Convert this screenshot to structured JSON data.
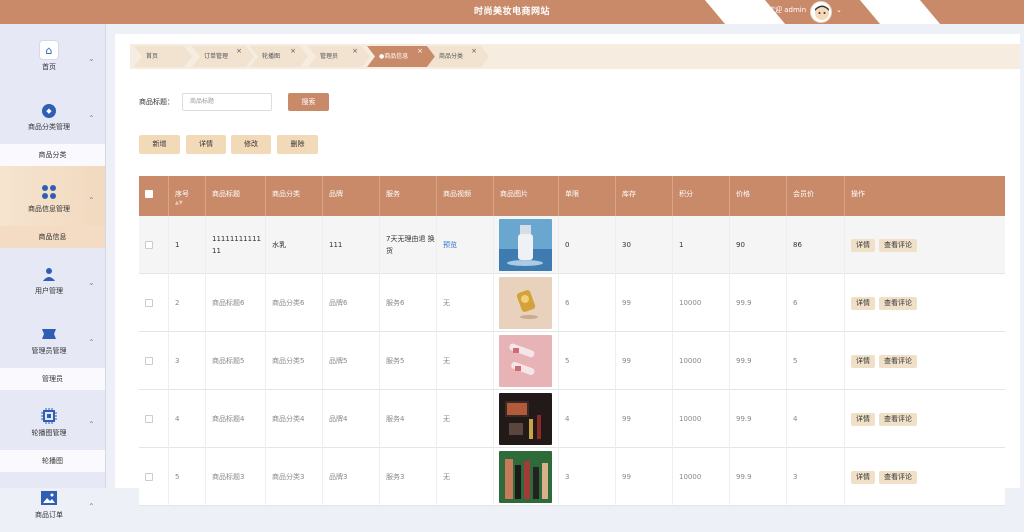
{
  "header": {
    "title": "时尚美妆电商网站",
    "welcome": "欢迎 admin"
  },
  "sidebar": {
    "groups": [
      {
        "label": "首页",
        "icon": "home-icon"
      },
      {
        "label": "商品分类管理",
        "icon": "category-icon",
        "sub": "商品分类"
      },
      {
        "label": "商品信息管理",
        "icon": "grid-icon",
        "sub": "商品信息"
      },
      {
        "label": "用户管理",
        "icon": "user-icon"
      },
      {
        "label": "管理员管理",
        "icon": "admin-icon",
        "sub": "管理员"
      },
      {
        "label": "轮播图管理",
        "icon": "chip-icon",
        "sub": "轮播图"
      },
      {
        "label": "商品订单",
        "icon": "image-icon"
      }
    ]
  },
  "tabs": [
    "首页",
    "订单管理",
    "轮播图",
    "管理员",
    "●商品信息",
    "商品分类"
  ],
  "search": {
    "label": "商品标题：",
    "placeholder": "商品标题",
    "button": "搜索"
  },
  "actions": {
    "add": "新增",
    "detail": "详情",
    "edit": "修改",
    "delete": "删除"
  },
  "table": {
    "headers": [
      "序号",
      "商品标题",
      "商品分类",
      "品牌",
      "服务",
      "商品视频",
      "商品图片",
      "单限",
      "库存",
      "积分",
      "价格",
      "会员价",
      "操作"
    ],
    "rows": [
      {
        "no": "1",
        "title": "11111111111 11",
        "category": "水乳",
        "brand": "111",
        "service": "7天无理由退 换货",
        "video": "预览",
        "limit": "0",
        "stock": "30",
        "points": "1",
        "price": "90",
        "member": "86"
      },
      {
        "no": "2",
        "title": "商品标题6",
        "category": "商品分类6",
        "brand": "品牌6",
        "service": "服务6",
        "video": "无",
        "limit": "6",
        "stock": "99",
        "points": "10000",
        "price": "99.9",
        "member": "6"
      },
      {
        "no": "3",
        "title": "商品标题5",
        "category": "商品分类5",
        "brand": "品牌5",
        "service": "服务5",
        "video": "无",
        "limit": "5",
        "stock": "99",
        "points": "10000",
        "price": "99.9",
        "member": "5"
      },
      {
        "no": "4",
        "title": "商品标题4",
        "category": "商品分类4",
        "brand": "品牌4",
        "service": "服务4",
        "video": "无",
        "limit": "4",
        "stock": "99",
        "points": "10000",
        "price": "99.9",
        "member": "4"
      },
      {
        "no": "5",
        "title": "商品标题3",
        "category": "商品分类3",
        "brand": "品牌3",
        "service": "服务3",
        "video": "无",
        "limit": "3",
        "stock": "99",
        "points": "10000",
        "price": "99.9",
        "member": "3"
      }
    ],
    "row_actions": {
      "detail": "详情",
      "review": "查看评论"
    }
  },
  "colors": {
    "accent": "#c98a6a",
    "button": "#f2d9b8",
    "link": "#2f6fd0",
    "sidebar": "#e7e8f5"
  }
}
